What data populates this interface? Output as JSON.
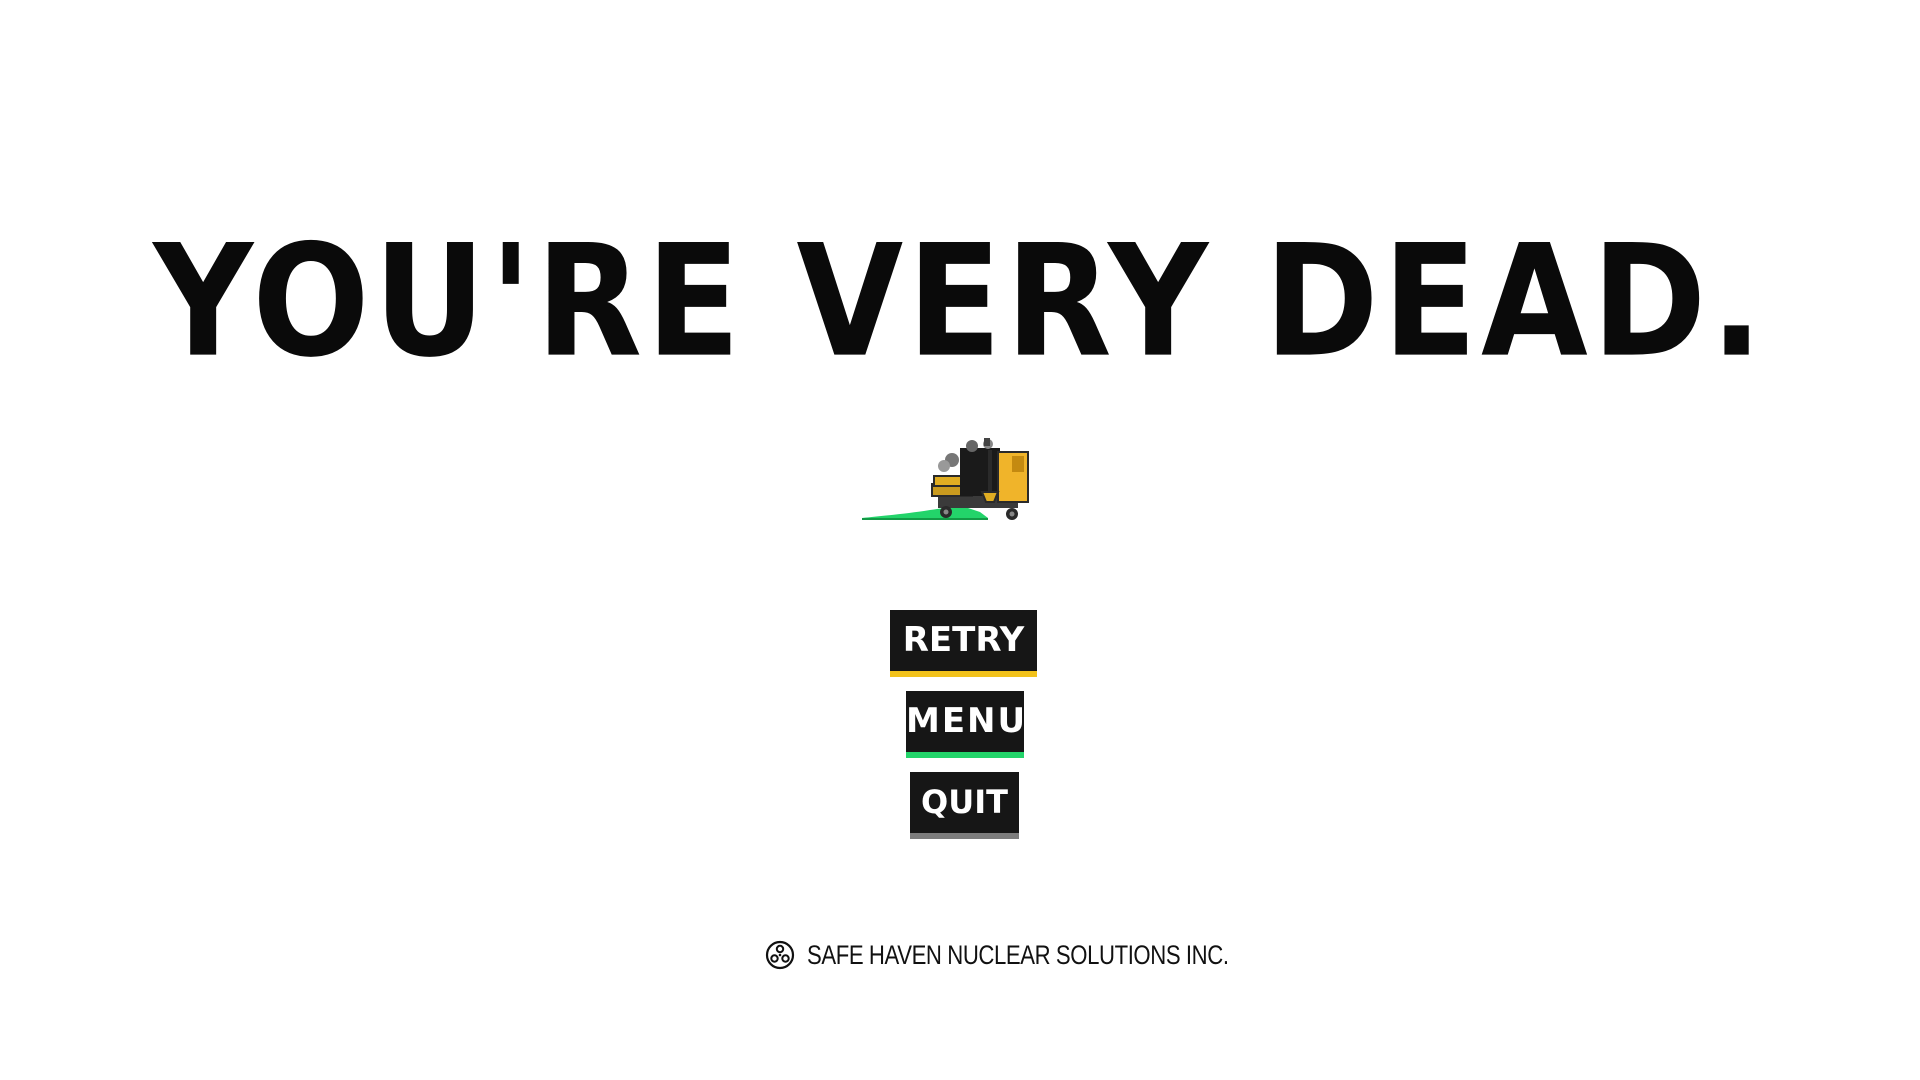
{
  "game_over": {
    "title": "YOU'RE VERY DEAD."
  },
  "character": {
    "icon": "janitor-cart-sprite",
    "slime_color": "#23d46a"
  },
  "menu": {
    "retry_label": "RETRY",
    "menu_label": "MENU",
    "quit_label": "QUIT",
    "retry_accent": "#f2c21b",
    "menu_accent": "#23d46a",
    "quit_accent": "#7d7d7d"
  },
  "footer": {
    "logo_icon": "nuclear-logo-icon",
    "company": "SAFE HAVEN NUCLEAR SOLUTIONS INC."
  }
}
